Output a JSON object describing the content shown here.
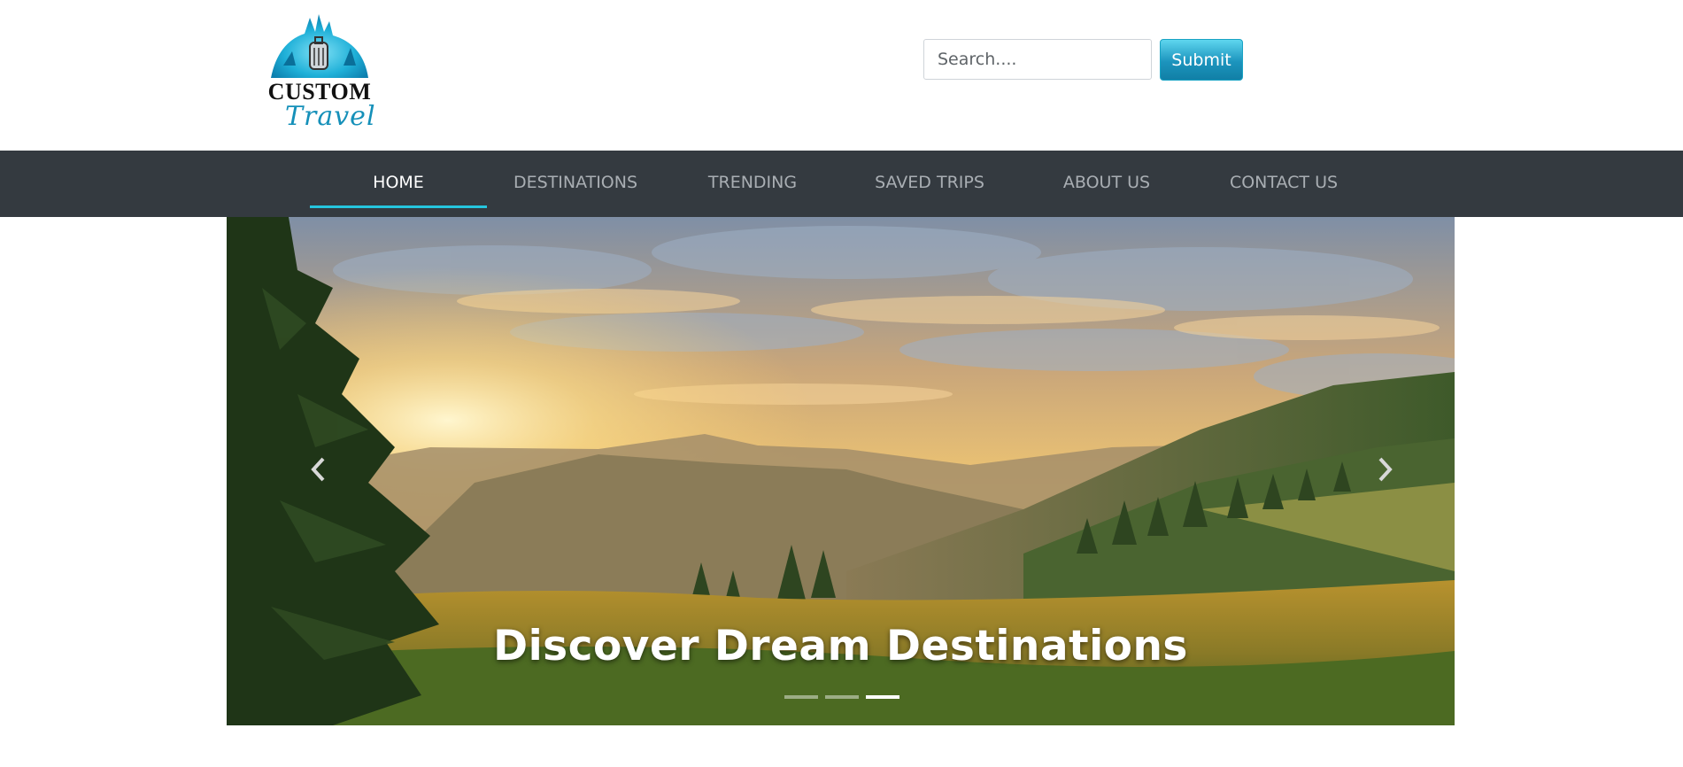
{
  "brand": {
    "name_line1": "CUSTOM",
    "name_line2": "Travel"
  },
  "search": {
    "placeholder": "Search....",
    "value": "",
    "submit_label": "Submit"
  },
  "nav": {
    "items": [
      {
        "label": "HOME",
        "active": true
      },
      {
        "label": "DESTINATIONS",
        "active": false
      },
      {
        "label": "TRENDING",
        "active": false
      },
      {
        "label": "SAVED TRIPS",
        "active": false
      },
      {
        "label": "ABOUT US",
        "active": false
      },
      {
        "label": "CONTACT US",
        "active": false
      }
    ]
  },
  "carousel": {
    "caption": "Discover Dream Destinations",
    "slide_count": 3,
    "active_slide": 3,
    "prev_icon": "chevron-left-icon",
    "next_icon": "chevron-right-icon"
  },
  "colors": {
    "navbar_bg": "#343a40",
    "nav_active_underline": "#25c5de",
    "submit_bg": "#1c94bd",
    "brand_blue": "#1590b9"
  }
}
